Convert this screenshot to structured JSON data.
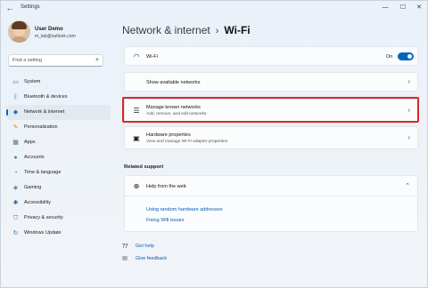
{
  "window": {
    "title": "Settings"
  },
  "user": {
    "name": "User Demo",
    "email": "m_lab@outlook.com"
  },
  "search": {
    "placeholder": "Find a setting"
  },
  "nav": [
    {
      "label": "System",
      "icon": "monitor-icon",
      "color": "#1a73c7"
    },
    {
      "label": "Bluetooth & devices",
      "icon": "bluetooth-icon",
      "color": "#1a73c7"
    },
    {
      "label": "Network & internet",
      "icon": "wifi-icon",
      "color": "#1a73c7",
      "active": true
    },
    {
      "label": "Personalization",
      "icon": "brush-icon",
      "color": "#d9822b"
    },
    {
      "label": "Apps",
      "icon": "apps-icon",
      "color": "#5b6b7d"
    },
    {
      "label": "Accounts",
      "icon": "person-icon",
      "color": "#2e9e5b"
    },
    {
      "label": "Time & language",
      "icon": "globe-clock-icon",
      "color": "#1a73c7"
    },
    {
      "label": "Gaming",
      "icon": "gamepad-icon",
      "color": "#5b6b7d"
    },
    {
      "label": "Accessibility",
      "icon": "accessibility-icon",
      "color": "#1a73c7"
    },
    {
      "label": "Privacy & security",
      "icon": "shield-icon",
      "color": "#5b6b7d"
    },
    {
      "label": "Windows Update",
      "icon": "update-icon",
      "color": "#1a73c7"
    }
  ],
  "breadcrumb": {
    "parent": "Network & internet",
    "separator": "›",
    "current": "Wi-Fi"
  },
  "wifi": {
    "label": "Wi-Fi",
    "state": "On"
  },
  "show_networks": {
    "label": "Show available networks"
  },
  "manage_networks": {
    "title": "Manage known networks",
    "subtitle": "Add, remove, and edit networks"
  },
  "hardware": {
    "title": "Hardware properties",
    "subtitle": "View and manage Wi-Fi adapter properties"
  },
  "related": {
    "section_title": "Related support",
    "help_title": "Help from the web",
    "links": [
      "Using random hardware addresses",
      "Fixing Wifi issues"
    ]
  },
  "footer": {
    "get_help": "Get help",
    "feedback": "Give feedback"
  },
  "colors": {
    "accent": "#0067c0",
    "highlight": "#d62828"
  }
}
